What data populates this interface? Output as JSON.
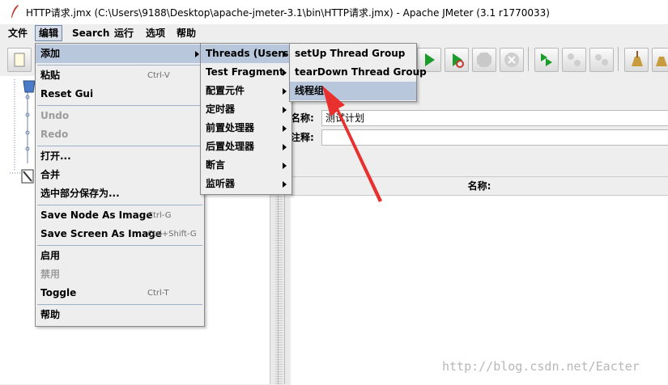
{
  "window": {
    "title": "HTTP请求.jmx (C:\\Users\\9188\\Desktop\\apache-jmeter-3.1\\bin\\HTTP请求.jmx) - Apache JMeter (3.1 r1770033)"
  },
  "menubar": {
    "items": [
      "文件",
      "编辑",
      "Search",
      "运行",
      "选项",
      "帮助"
    ],
    "active": "编辑"
  },
  "edit_menu": {
    "add": "添加",
    "paste": "粘贴",
    "paste_acc": "Ctrl-V",
    "reset_gui": "Reset Gui",
    "undo": "Undo",
    "redo": "Redo",
    "open": "打开...",
    "merge": "合并",
    "save_selection": "选中部分保存为...",
    "save_node_image": "Save Node As Image",
    "save_node_acc": "Ctrl-G",
    "save_screen_image": "Save Screen As Image",
    "save_screen_acc": "Ctrl+Shift-G",
    "enable": "启用",
    "disable": "禁用",
    "toggle": "Toggle",
    "toggle_acc": "Ctrl-T",
    "help": "帮助"
  },
  "add_menu": {
    "threads": "Threads (Users)",
    "test_fragment": "Test Fragment",
    "config": "配置元件",
    "timer": "定时器",
    "pre": "前置处理器",
    "post": "后置处理器",
    "assert": "断言",
    "listener": "监听器"
  },
  "threads_menu": {
    "setup": "setUp Thread Group",
    "teardown": "tearDown Thread Group",
    "thread_group": "线程组"
  },
  "right_panel": {
    "name_label": "名称:",
    "name_value": "测试计划",
    "comment_label": "注释:",
    "table_header": "名称:"
  },
  "watermark": "http://blog.csdn.net/Eacter",
  "colors": {
    "highlight": "#b8c7dc",
    "arrow": "#e8302e"
  }
}
